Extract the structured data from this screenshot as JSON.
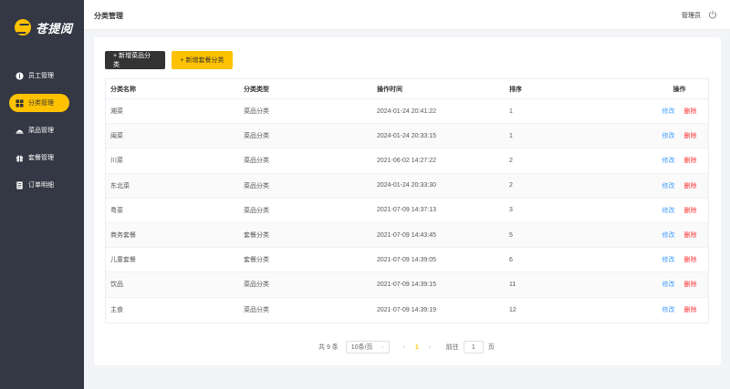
{
  "brand": {
    "name": "苍提阅",
    "accent": "#ffc200",
    "sidebar_bg": "#343744"
  },
  "sidebar": {
    "items": [
      {
        "label": "员工管理",
        "icon": "info-icon",
        "active": false
      },
      {
        "label": "分类管理",
        "icon": "grid-icon",
        "active": true
      },
      {
        "label": "菜品管理",
        "icon": "dish-icon",
        "active": false
      },
      {
        "label": "套餐管理",
        "icon": "gift-icon",
        "active": false
      },
      {
        "label": "订单明细",
        "icon": "document-icon",
        "active": false
      }
    ]
  },
  "header": {
    "title": "分类管理",
    "user": "管理员",
    "logout_icon": "power-icon"
  },
  "toolbar": {
    "add_dish_category": "+ 新增菜品分类",
    "add_combo_category": "+ 新增套餐分类"
  },
  "table": {
    "columns": [
      "分类名称",
      "分类类型",
      "操作时间",
      "排序",
      "操作"
    ],
    "rows": [
      {
        "name": "湘菜",
        "type": "菜品分类",
        "time": "2024-01-24 20:41:22",
        "sort": "1"
      },
      {
        "name": "闽菜",
        "type": "菜品分类",
        "time": "2024-01-24 20:33:15",
        "sort": "1"
      },
      {
        "name": "川菜",
        "type": "菜品分类",
        "time": "2021-06-02 14:27:22",
        "sort": "2"
      },
      {
        "name": "东北菜",
        "type": "菜品分类",
        "time": "2024-01-24 20:33:30",
        "sort": "2"
      },
      {
        "name": "粤菜",
        "type": "菜品分类",
        "time": "2021-07-09 14:37:13",
        "sort": "3"
      },
      {
        "name": "商务套餐",
        "type": "套餐分类",
        "time": "2021-07-09 14:43:45",
        "sort": "5"
      },
      {
        "name": "儿童套餐",
        "type": "套餐分类",
        "time": "2021-07-09 14:39:05",
        "sort": "6"
      },
      {
        "name": "饮品",
        "type": "菜品分类",
        "time": "2021-07-09 14:39:15",
        "sort": "11"
      },
      {
        "name": "主食",
        "type": "菜品分类",
        "time": "2021-07-09 14:39:19",
        "sort": "12"
      }
    ],
    "edit_label": "修改",
    "delete_label": "删除"
  },
  "pagination": {
    "total": "共 9 条",
    "page_size": "10条/页",
    "prev": "‹",
    "current_page": "1",
    "next": "›",
    "goto_prefix": "前往",
    "goto_value": "1",
    "goto_suffix": "页"
  }
}
